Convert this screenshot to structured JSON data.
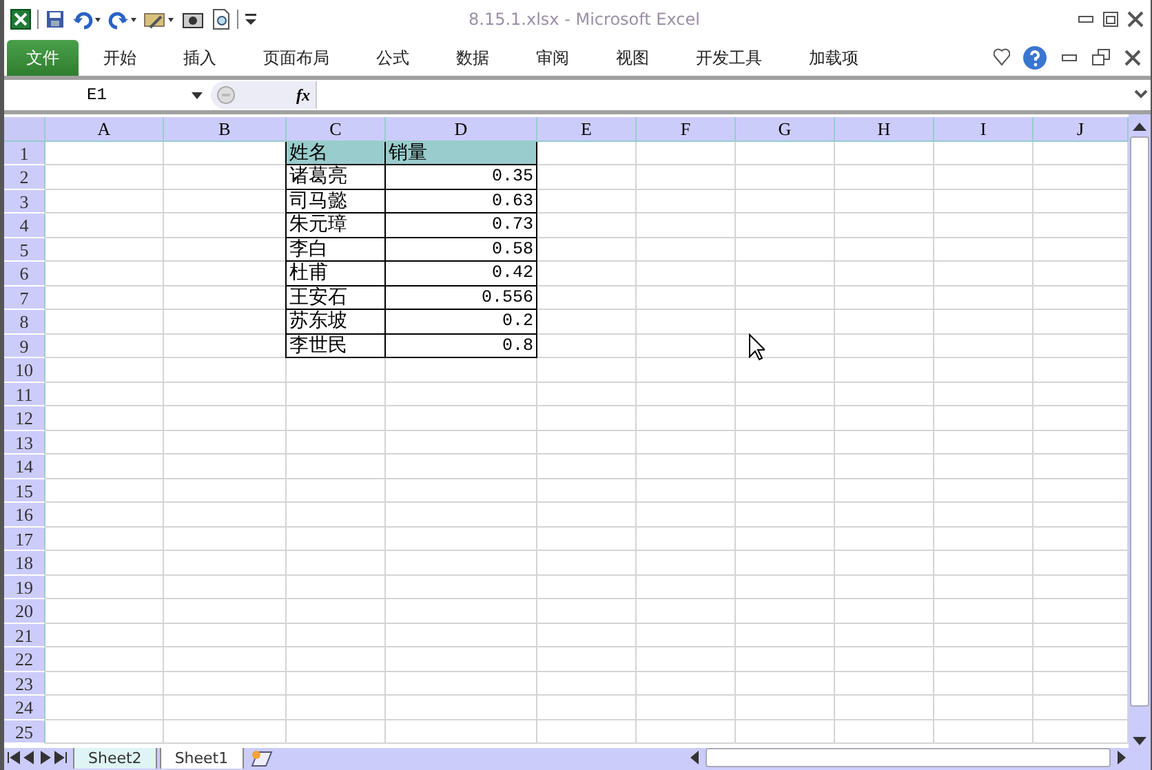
{
  "window": {
    "title": "8.15.1.xlsx  -  Microsoft Excel"
  },
  "ribbon_tabs": [
    {
      "label": "文件",
      "selected": true
    },
    {
      "label": "开始",
      "selected": false
    },
    {
      "label": "插入",
      "selected": false
    },
    {
      "label": "页面布局",
      "selected": false
    },
    {
      "label": "公式",
      "selected": false
    },
    {
      "label": "数据",
      "selected": false
    },
    {
      "label": "审阅",
      "selected": false
    },
    {
      "label": "视图",
      "selected": false
    },
    {
      "label": "开发工具",
      "selected": false
    },
    {
      "label": "加载项",
      "selected": false
    }
  ],
  "formula_bar": {
    "name_box": "E1",
    "fx": "fx"
  },
  "sheet": {
    "column_headers": [
      "A",
      "B",
      "C",
      "D",
      "E",
      "F",
      "G",
      "H",
      "I",
      "J"
    ],
    "row_headers": [
      "1",
      "2",
      "3",
      "4",
      "5",
      "6",
      "7",
      "8",
      "9",
      "10",
      "11",
      "12",
      "13",
      "14",
      "15",
      "16",
      "17",
      "18",
      "19",
      "20",
      "21",
      "22",
      "23",
      "24",
      "25"
    ],
    "table": {
      "columns": [
        "姓名",
        "销量"
      ],
      "rows": [
        [
          "诸葛亮",
          "0.35"
        ],
        [
          "司马懿",
          "0.63"
        ],
        [
          "朱元璋",
          "0.73"
        ],
        [
          "李白",
          "0.58"
        ],
        [
          "杜甫",
          "0.42"
        ],
        [
          "王安石",
          "0.556"
        ],
        [
          "苏东坡",
          "0.2"
        ],
        [
          "李世民",
          "0.8"
        ]
      ]
    }
  },
  "sheet_tabs": [
    {
      "label": "Sheet2",
      "selected": false
    },
    {
      "label": "Sheet1",
      "selected": true
    }
  ]
}
